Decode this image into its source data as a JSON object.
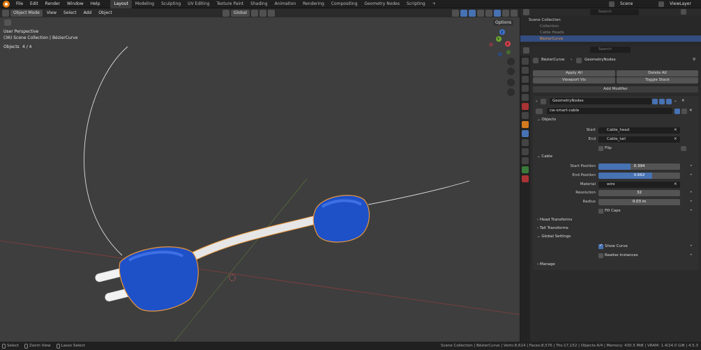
{
  "menubar": {
    "menus": [
      "File",
      "Edit",
      "Render",
      "Window",
      "Help"
    ],
    "workspaces": [
      "Layout",
      "Modeling",
      "Sculpting",
      "UV Editing",
      "Texture Paint",
      "Shading",
      "Animation",
      "Rendering",
      "Compositing",
      "Geometry Nodes",
      "Scripting"
    ],
    "active_workspace": "Layout",
    "add_tab": "+",
    "scene": "Scene",
    "view_layer": "ViewLayer"
  },
  "viewport": {
    "mode": "Object Mode",
    "menus": [
      "View",
      "Select",
      "Add",
      "Object"
    ],
    "orientation": "Global",
    "options": "Options",
    "perspective": "User Perspective",
    "collection_info": "(36) Scene Collection | BézierCurve",
    "objects_label": "Objects",
    "objects_count": "4 / 4",
    "gizmo": {
      "x": "X",
      "y": "Y",
      "z": "Z"
    }
  },
  "outliner": {
    "search_placeholder": "Search",
    "rows": [
      "Scene Collection",
      "Collection",
      "Cable Heads",
      "BézierCurve"
    ]
  },
  "properties": {
    "search_placeholder": "Search",
    "breadcrumb_object": "BézierCurve",
    "breadcrumb_modifier": "GeometryNodes",
    "apply_all": "Apply All",
    "delete_all": "Delete All",
    "viewport_vis": "Viewport Vis",
    "toggle_stack": "Toggle Stack",
    "add_modifier": "Add Modifier",
    "modifier_name": "GeometryNodes",
    "node_group": "cw-smart-cable",
    "sections": {
      "objects": "Objects",
      "cable": "Cable",
      "head_transforms": "Head Transforms",
      "tail_transforms": "Tail Transforms",
      "global_settings": "Global Settings",
      "manage": "Manage"
    },
    "start_label": "Start",
    "start_value": "Cable_head",
    "end_label": "End",
    "end_value": "Cable_tail",
    "flip_label": "Flip",
    "start_position_label": "Start Position",
    "start_position_value": "0.394",
    "start_position_fraction": 0.394,
    "end_position_label": "End Position",
    "end_position_value": "0.662",
    "end_position_fraction": 0.662,
    "material_label": "Material",
    "material_value": "wire",
    "resolution_label": "Resolution",
    "resolution_value": "32",
    "radius_label": "Radius",
    "radius_value": "0.03 m",
    "fill_caps_label": "Fill Caps",
    "show_curve_label": "Show Curve",
    "show_curve_checked": true,
    "realise_instances_label": "Realise Instances",
    "realise_instances_checked": false
  },
  "statusbar": {
    "select": "Select",
    "zoom_view": "Zoom View",
    "lasso_select": "Lasso Select",
    "stats": "Scene Collection | BézierCurve | Verts:8,614 | Faces:8,576 | Tris:17,152 | Objects:4/4 | Memory: 430.5 MiB | VRAM: 1.4/24.0 GiB | 4.5.3"
  },
  "colors": {
    "accent": "#4772b3",
    "plug_blue": "#1e50c8",
    "selection_orange": "#e8963c",
    "viewport_bg": "#3e3e3e"
  }
}
